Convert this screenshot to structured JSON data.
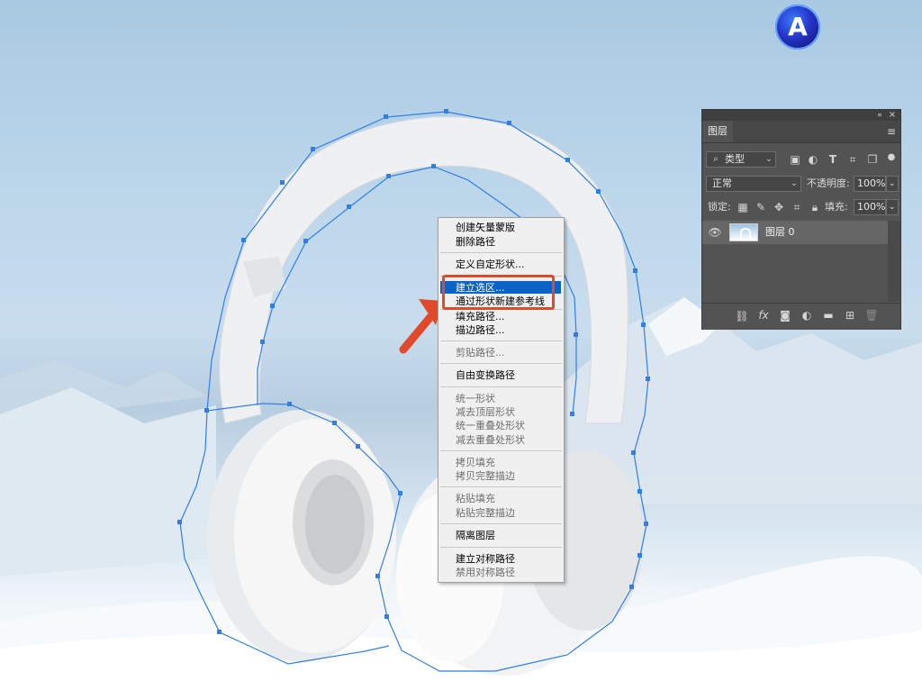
{
  "context_menu": {
    "items": [
      {
        "label": "创建矢量蒙版",
        "enabled": true
      },
      {
        "label": "删除路径",
        "enabled": true
      },
      {
        "label": "定义自定形状...",
        "enabled": true
      },
      {
        "label": "建立选区...",
        "enabled": true,
        "selected": true
      },
      {
        "label": "通过形状新建参考线",
        "enabled": true
      },
      {
        "label": "填充路径...",
        "enabled": true
      },
      {
        "label": "描边路径...",
        "enabled": true
      },
      {
        "label": "剪贴路径...",
        "enabled": false
      },
      {
        "label": "自由变换路径",
        "enabled": true
      },
      {
        "label": "统一形状",
        "enabled": false
      },
      {
        "label": "减去顶层形状",
        "enabled": false
      },
      {
        "label": "统一重叠处形状",
        "enabled": false
      },
      {
        "label": "减去重叠处形状",
        "enabled": false
      },
      {
        "label": "拷贝填充",
        "enabled": false
      },
      {
        "label": "拷贝完整描边",
        "enabled": false
      },
      {
        "label": "粘贴填充",
        "enabled": false
      },
      {
        "label": "粘贴完整描边",
        "enabled": false
      },
      {
        "label": "隔离图层",
        "enabled": true
      },
      {
        "label": "建立对称路径",
        "enabled": true
      },
      {
        "label": "禁用对称路径",
        "enabled": false
      }
    ]
  },
  "layers_panel": {
    "tab": "图层",
    "filter_kind": "类型",
    "blend_mode": "正常",
    "opacity_label": "不透明度:",
    "opacity_value": "100%",
    "lock_label": "锁定:",
    "fill_label": "填充:",
    "fill_value": "100%",
    "layer_name": "图层 0"
  },
  "logo": {
    "letter": "A"
  },
  "colors": {
    "path_stroke": "#2f7fe6",
    "menu_highlight": "#0a64c8",
    "annotation": "#e04a2b",
    "panel_bg": "#535353"
  }
}
